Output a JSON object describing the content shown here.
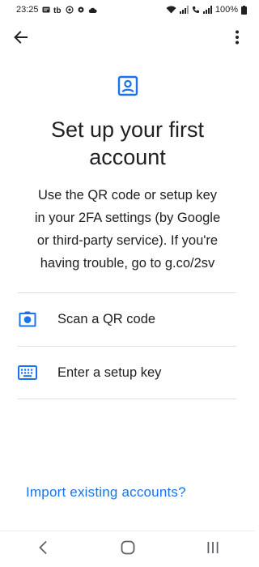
{
  "status_bar": {
    "time": "23:25",
    "battery": "100%"
  },
  "app_bar": {
    "back_icon": "arrow-back-icon",
    "menu_icon": "more-vert-icon"
  },
  "header": {
    "icon": "account-box-icon",
    "title_lines": [
      "Set up your first",
      "account"
    ],
    "description_lines": [
      "Use the QR code or setup key",
      "in your 2FA settings (by Google",
      "or third-party service). If you're",
      "having trouble, go to g.co/2sv"
    ]
  },
  "options": [
    {
      "icon": "camera-icon",
      "label": "Scan a QR code"
    },
    {
      "icon": "keyboard-icon",
      "label": "Enter a setup key"
    }
  ],
  "import_link": "Import existing accounts?",
  "colors": {
    "accent": "#1a73e8",
    "icon_blue": "#1a73e8",
    "text": "#202124",
    "divider": "#e0e0e0"
  },
  "nav_bar": {
    "back": "nav-back-icon",
    "home": "nav-home-icon",
    "recents": "nav-recents-icon"
  }
}
